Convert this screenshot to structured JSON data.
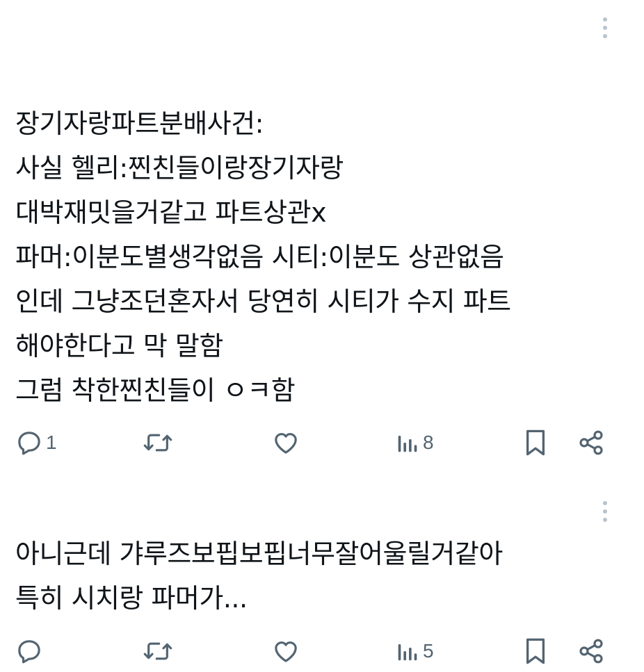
{
  "posts": [
    {
      "text": "장기자랑파트분배사건:\n사실 헬리:찐친들이랑장기자랑\n대박재밋을거같고 파트상관x\n파머:이분도별생각없음 시티:이분도 상관없음\n인데 그냥조던혼자서 당연히 시티가 수지 파트\n해야한다고 막 말함\n그럼 착한찐친들이 ㅇㅋ함",
      "reply_count": "1",
      "retweet_count": "",
      "like_count": "",
      "view_count": "8"
    },
    {
      "text": "아니근데 갸루즈보핍보핍너무잘어울릴거같아\n특히 시치랑 파머가...",
      "reply_count": "",
      "retweet_count": "",
      "like_count": "",
      "view_count": "5"
    }
  ],
  "icons": {
    "more": "more-vertical-icon",
    "reply": "reply-icon",
    "retweet": "retweet-icon",
    "like": "heart-icon",
    "views": "views-icon",
    "bookmark": "bookmark-icon",
    "share": "share-icon"
  },
  "colors": {
    "text": "#0f1419",
    "icon": "#536471",
    "more_dots": "#b9c3cc"
  }
}
